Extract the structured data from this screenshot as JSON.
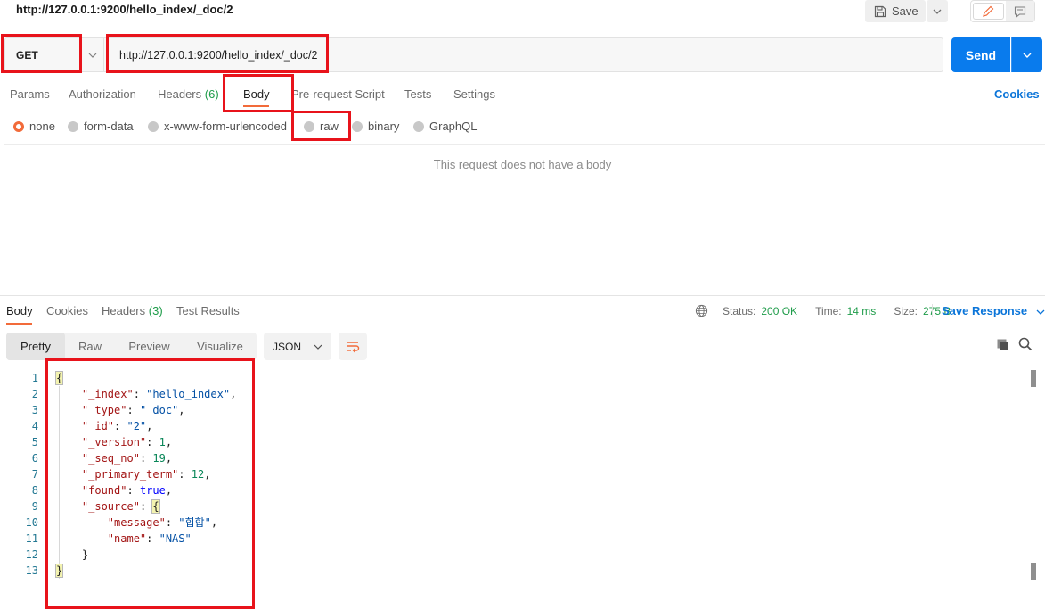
{
  "request": {
    "title": "http://127.0.0.1:9200/hello_index/_doc/2",
    "save_label": "Save",
    "method": "GET",
    "url": "http://127.0.0.1:9200/hello_index/_doc/2",
    "send_label": "Send"
  },
  "request_tabs": [
    {
      "label": "Params"
    },
    {
      "label": "Authorization"
    },
    {
      "label": "Headers",
      "count": "(6)"
    },
    {
      "label": "Body"
    },
    {
      "label": "Pre-request Script"
    },
    {
      "label": "Tests"
    },
    {
      "label": "Settings"
    }
  ],
  "cookies_label": "Cookies",
  "body_types": [
    {
      "label": "none",
      "selected": true
    },
    {
      "label": "form-data"
    },
    {
      "label": "x-www-form-urlencoded"
    },
    {
      "label": "raw"
    },
    {
      "label": "binary"
    },
    {
      "label": "GraphQL"
    }
  ],
  "no_body_message": "This request does not have a body",
  "response_tabs": [
    {
      "label": "Body"
    },
    {
      "label": "Cookies"
    },
    {
      "label": "Headers",
      "count": "(3)"
    },
    {
      "label": "Test Results"
    }
  ],
  "status": {
    "status_label": "Status:",
    "status_value": "200 OK",
    "time_label": "Time:",
    "time_value": "14 ms",
    "size_label": "Size:",
    "size_value": "275 B"
  },
  "save_response_label": "Save Response",
  "view_modes": [
    {
      "label": "Pretty"
    },
    {
      "label": "Raw"
    },
    {
      "label": "Preview"
    },
    {
      "label": "Visualize"
    }
  ],
  "format": "JSON",
  "colors": {
    "accent": "#f26b3a",
    "send": "#097bed",
    "link": "#0b75d9",
    "success": "#1f9c4a",
    "highlight": "#e8131b"
  },
  "code": {
    "line_numbers": [
      "1",
      "2",
      "3",
      "4",
      "5",
      "6",
      "7",
      "8",
      "9",
      "10",
      "11",
      "12",
      "13"
    ],
    "keys": {
      "index": "\"_index\"",
      "type": "\"_type\"",
      "id": "\"_id\"",
      "version": "\"_version\"",
      "seq_no": "\"_seq_no\"",
      "primary_term": "\"_primary_term\"",
      "found": "\"found\"",
      "source": "\"_source\"",
      "message": "\"message\"",
      "name": "\"name\""
    },
    "values": {
      "index": "\"hello_index\"",
      "type": "\"_doc\"",
      "id": "\"2\"",
      "version": "1",
      "seq_no": "19",
      "primary_term": "12",
      "found": "true",
      "message": "\"힙합\"",
      "name": "\"NAS\""
    }
  }
}
